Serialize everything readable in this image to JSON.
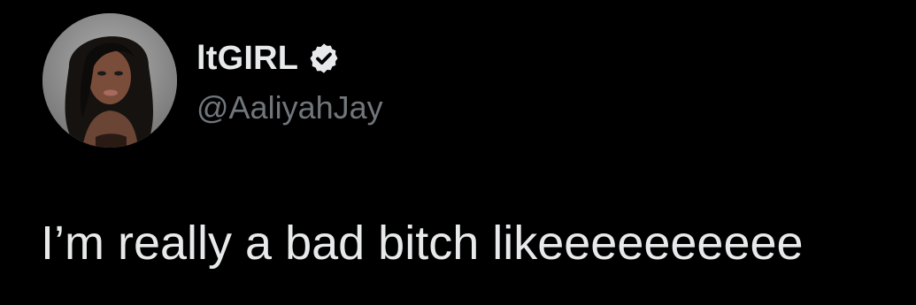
{
  "tweet": {
    "author": {
      "display_name": "ltGIRL",
      "handle": "@AaliyahJay",
      "verified": true,
      "avatar": "profile-photo"
    },
    "text": "I’m really a bad bitch likeeeeeeeeee"
  },
  "colors": {
    "background": "#000000",
    "primary_text": "#e7e9ea",
    "secondary_text": "#71767b",
    "verified_badge": "#e7e9ea"
  }
}
